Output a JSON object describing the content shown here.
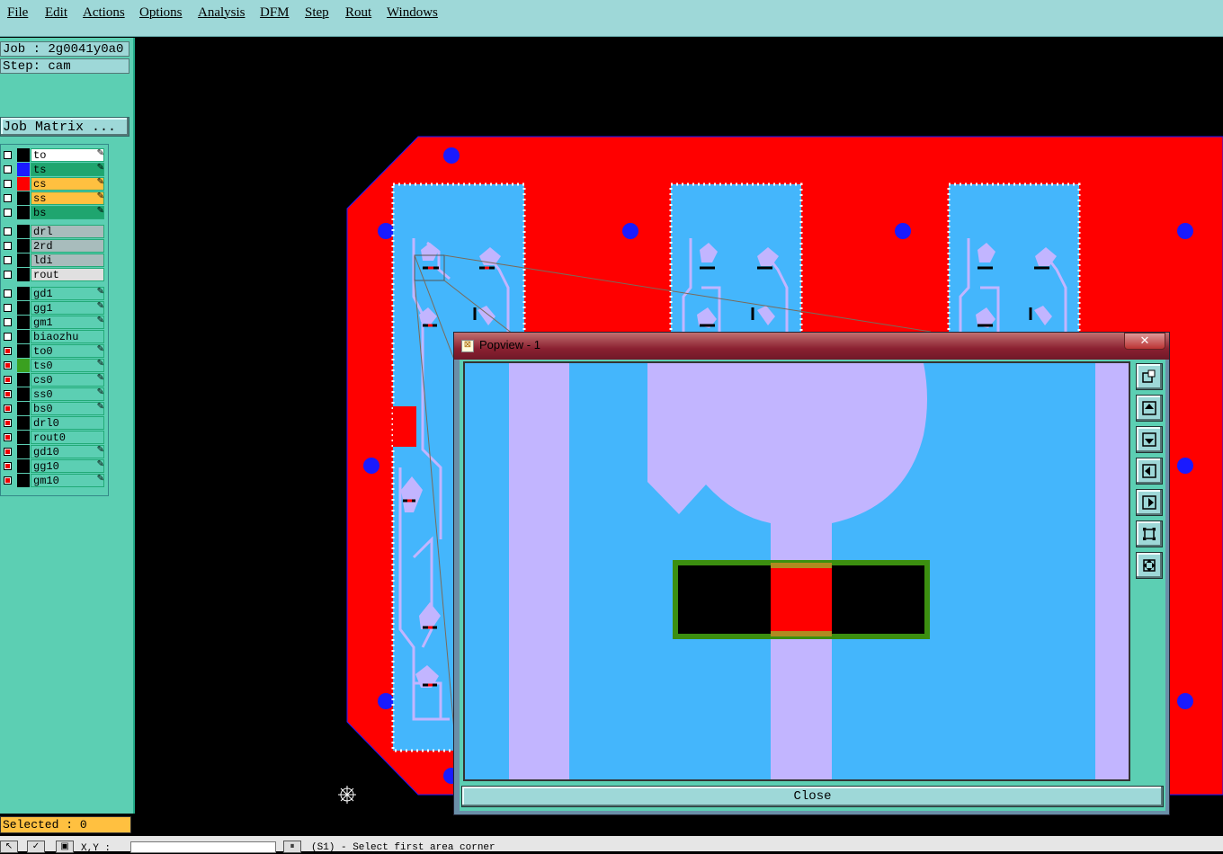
{
  "menu": {
    "items": [
      "File",
      "Edit",
      "Actions",
      "Options",
      "Analysis",
      "DFM",
      "Step",
      "Rout",
      "Windows"
    ]
  },
  "panel": {
    "job": "Job : 2g0041y0a0",
    "step": "Step: cam",
    "job_matrix": "Job Matrix ..."
  },
  "layers": [
    {
      "name": "to",
      "bg": "#ffffff",
      "swatch": "#000000",
      "edit": true
    },
    {
      "name": "ts",
      "bg": "#1fa56f",
      "swatch": "#1a1aff",
      "edit": true
    },
    {
      "name": "cs",
      "bg": "#ffc040",
      "swatch": "#ff0000",
      "edit": true
    },
    {
      "name": "ss",
      "bg": "#ffc040",
      "swatch": "#000000",
      "edit": true
    },
    {
      "name": "bs",
      "bg": "#1fa56f",
      "swatch": "#000000",
      "edit": true
    },
    {
      "name": "drl",
      "bg": "#a8bcbc",
      "swatch": "#000000",
      "edit": false
    },
    {
      "name": "2rd",
      "bg": "#a8bcbc",
      "swatch": "#000000",
      "edit": false
    },
    {
      "name": "ldi",
      "bg": "#a8bcbc",
      "swatch": "#000000",
      "edit": false
    },
    {
      "name": "rout",
      "bg": "#e0e0e0",
      "swatch": "#000000",
      "edit": false
    },
    {
      "name": "gd1",
      "bg": "#5ccfb3",
      "swatch": "#000000",
      "edit": true
    },
    {
      "name": "gg1",
      "bg": "#5ccfb3",
      "swatch": "#000000",
      "edit": true
    },
    {
      "name": "gm1",
      "bg": "#5ccfb3",
      "swatch": "#000000",
      "edit": true
    },
    {
      "name": "biaozhu",
      "bg": "#5ccfb3",
      "swatch": "#000000",
      "edit": false
    },
    {
      "name": "to0",
      "bg": "#5ccfb3",
      "swatch": "#000000",
      "edit": true
    },
    {
      "name": "ts0",
      "bg": "#5ccfb3",
      "swatch": "#3aa020",
      "edit": true
    },
    {
      "name": "cs0",
      "bg": "#5ccfb3",
      "swatch": "#000000",
      "edit": true
    },
    {
      "name": "ss0",
      "bg": "#5ccfb3",
      "swatch": "#000000",
      "edit": true
    },
    {
      "name": "bs0",
      "bg": "#5ccfb3",
      "swatch": "#000000",
      "edit": true
    },
    {
      "name": "drl0",
      "bg": "#5ccfb3",
      "swatch": "#000000",
      "edit": false
    },
    {
      "name": "rout0",
      "bg": "#5ccfb3",
      "swatch": "#000000",
      "edit": false
    },
    {
      "name": "gd10",
      "bg": "#5ccfb3",
      "swatch": "#000000",
      "edit": true
    },
    {
      "name": "gg10",
      "bg": "#5ccfb3",
      "swatch": "#000000",
      "edit": true
    },
    {
      "name": "gm10",
      "bg": "#5ccfb3",
      "swatch": "#000000",
      "edit": true
    }
  ],
  "status": {
    "selected": "Selected : 0",
    "prompt": "(S1) - Select first area corner",
    "xy_label": "X,Y :"
  },
  "popview": {
    "title": "Popview - 1",
    "close_label": "Close",
    "close_x": "✕"
  },
  "colors": {
    "board": "#ff0000",
    "panel_fill": "#44b6fc",
    "trace": "#c2b5ff",
    "pad_outline": "#3c8f10",
    "via": "#1a1aff"
  },
  "icons": [
    "zoom-icon",
    "pan-up-icon",
    "pan-down-icon",
    "pan-left-icon",
    "pan-right-icon",
    "zoom-fit-icon",
    "zoom-home-icon"
  ]
}
